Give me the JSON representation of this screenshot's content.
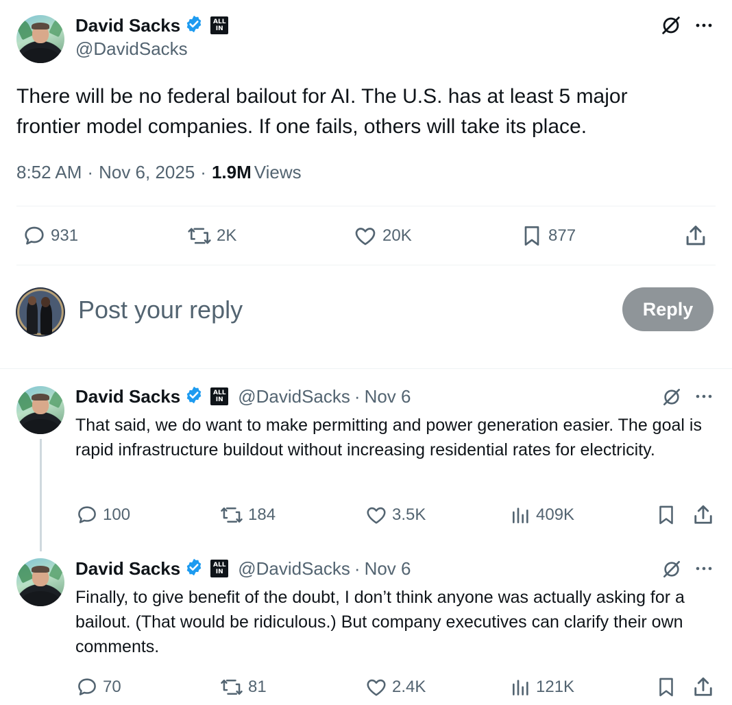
{
  "main_post": {
    "author_name": "David Sacks",
    "handle": "@DavidSacks",
    "badge_text": "ALL IN",
    "text": "There will be no federal bailout for AI. The U.S. has at least 5 major frontier model companies. If one fails, others will take its place.",
    "time": "8:52 AM",
    "date": "Nov 6, 2025",
    "views_count": "1.9M",
    "views_label": "Views",
    "replies": "931",
    "reposts": "2K",
    "likes": "20K",
    "bookmarks": "877"
  },
  "reply_composer": {
    "placeholder": "Post your reply",
    "button_label": "Reply"
  },
  "thread": [
    {
      "author_name": "David Sacks",
      "handle": "@DavidSacks",
      "date": "Nov 6",
      "text": "That said, we do want to make permitting and power generation easier. The goal is rapid infrastructure buildout without increasing residential rates for electricity.",
      "replies": "100",
      "reposts": "184",
      "likes": "3.5K",
      "views": "409K"
    },
    {
      "author_name": "David Sacks",
      "handle": "@DavidSacks",
      "date": "Nov 6",
      "text": "Finally, to give benefit of the doubt, I don’t think anyone was actually asking for a bailout. (That would be ridiculous.) But company executives can clarify their own comments.",
      "replies": "70",
      "reposts": "81",
      "likes": "2.4K",
      "views": "121K"
    }
  ],
  "separator": "·",
  "colors": {
    "text": "#0f1419",
    "secondary": "#536471",
    "verified_blue": "#1d9bf0",
    "reply_button_disabled": "#8f9599",
    "divider": "#eff3f4"
  }
}
